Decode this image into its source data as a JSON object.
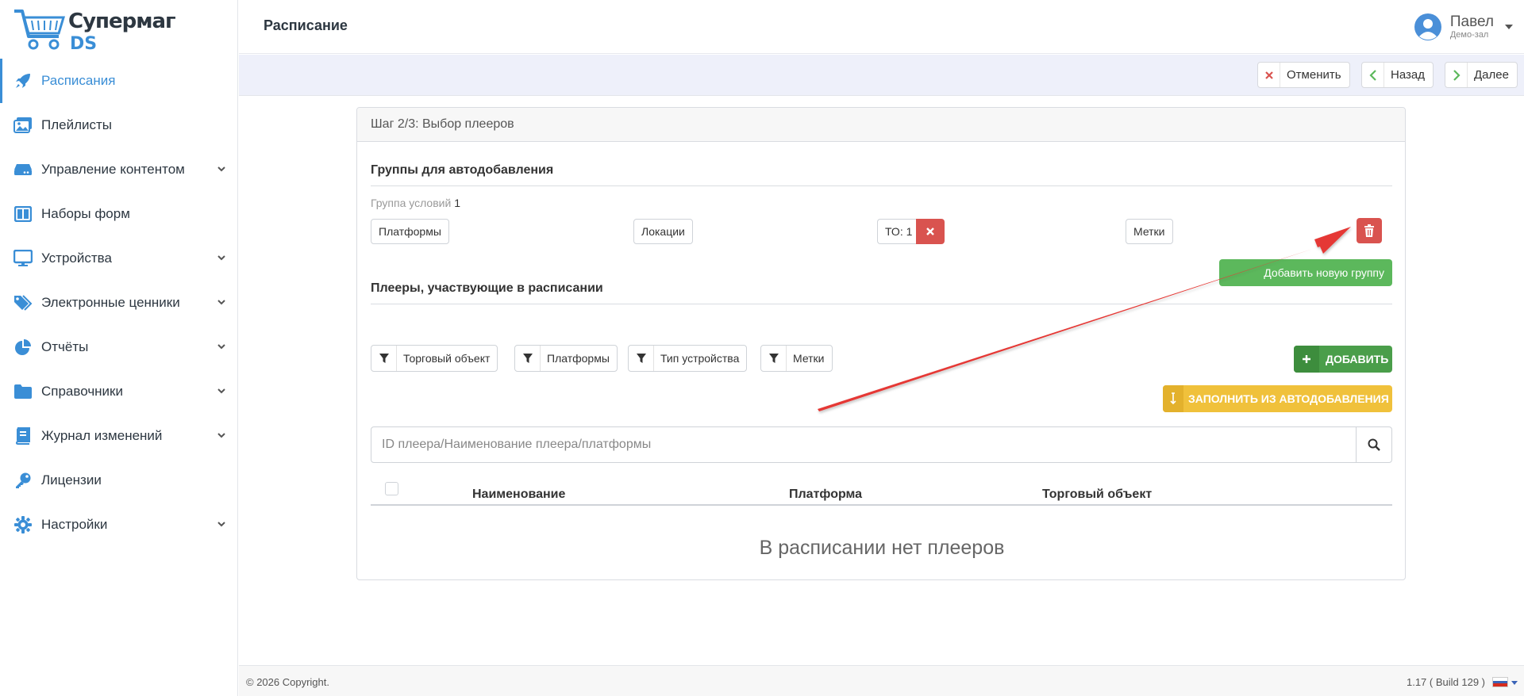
{
  "brand": {
    "line1": "Супермаг",
    "line2": "DS"
  },
  "sidebar": {
    "items": [
      {
        "label": "Расписания",
        "active": true,
        "expandable": false,
        "icon": "rocket-icon"
      },
      {
        "label": "Плейлисты",
        "active": false,
        "expandable": false,
        "icon": "images-icon"
      },
      {
        "label": "Управление контентом",
        "active": false,
        "expandable": true,
        "icon": "drive-icon"
      },
      {
        "label": "Наборы форм",
        "active": false,
        "expandable": false,
        "icon": "layout-icon"
      },
      {
        "label": "Устройства",
        "active": false,
        "expandable": true,
        "icon": "monitor-icon"
      },
      {
        "label": "Электронные ценники",
        "active": false,
        "expandable": true,
        "icon": "tags-icon"
      },
      {
        "label": "Отчёты",
        "active": false,
        "expandable": true,
        "icon": "pie-chart-icon"
      },
      {
        "label": "Справочники",
        "active": false,
        "expandable": true,
        "icon": "folder-icon"
      },
      {
        "label": "Журнал изменений",
        "active": false,
        "expandable": true,
        "icon": "book-icon"
      },
      {
        "label": "Лицензии",
        "active": false,
        "expandable": false,
        "icon": "key-icon"
      },
      {
        "label": "Настройки",
        "active": false,
        "expandable": true,
        "icon": "gear-icon"
      }
    ]
  },
  "header": {
    "title": "Расписание",
    "user": {
      "name": "Павел",
      "subtitle": "Демо-зал"
    }
  },
  "toolbar": {
    "cancel": "Отменить",
    "back": "Назад",
    "next": "Далее"
  },
  "card": {
    "step_title": "Шаг 2/3: Выбор плееров",
    "autoadd": {
      "title": "Группы для автодобавления",
      "group_label": "Группа условий",
      "group_number": "1",
      "platforms": "Платформы",
      "locations": "Локации",
      "to": "ТО: 1",
      "tags": "Метки",
      "add_group": "Добавить новую группу"
    },
    "players": {
      "title": "Плееры, участвующие в расписании",
      "filters": [
        "Торговый объект",
        "Платформы",
        "Тип устройства",
        "Метки"
      ],
      "add": "ДОБАВИТЬ",
      "fill": "ЗАПОЛНИТЬ ИЗ АВТОДОБАВЛЕНИЯ",
      "search_placeholder": "ID плеера/Наименование плеера/платформы",
      "columns": [
        "Наименование",
        "Платформа",
        "Торговый объект"
      ],
      "empty": "В расписании нет плееров"
    }
  },
  "footer": {
    "copyright": "© 2026 Copyright.",
    "version": "1.17 ( Build 129 )"
  },
  "colors": {
    "accent": "#3a8ed6",
    "sidebar_icon": "#5cb85c",
    "danger": "#d9534f",
    "success": "#5cb85c",
    "warning": "#f0c13b",
    "annotation_arrow": "#e53935"
  }
}
